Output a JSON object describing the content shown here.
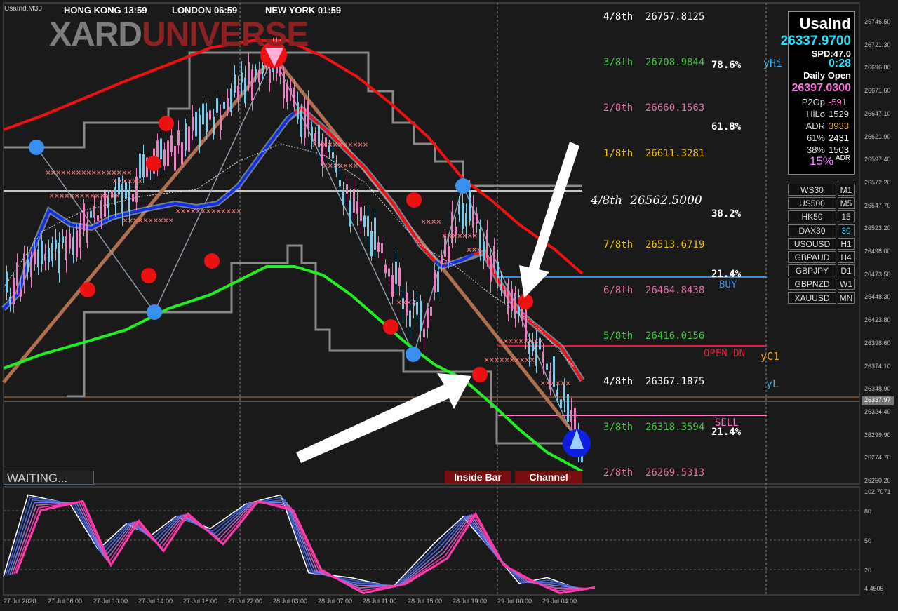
{
  "window": {
    "symbol_title": "UsaInd,M30"
  },
  "sessions": [
    {
      "label": "HONG KONG  13:59",
      "color": "#1f6fd0"
    },
    {
      "label": "LONDON  06:59",
      "color": "#a01a1a"
    },
    {
      "label": "NEW YORK  01:59",
      "color": "#a01a1a"
    }
  ],
  "brand": {
    "part1": "XARD",
    "part2": "UNIVERSE"
  },
  "murrey_levels": [
    {
      "name": "4/8th",
      "value": "26757.8125",
      "color": "#ffffff"
    },
    {
      "name": "3/8th",
      "value": "26708.9844",
      "color": "#3ec83e"
    },
    {
      "name": "2/8th",
      "value": "26660.1563",
      "color": "#e46fa6"
    },
    {
      "name": "1/8th",
      "value": "26611.3281",
      "color": "#f0c000"
    },
    {
      "name": "7/8th",
      "value": "26513.6719",
      "color": "#f0c000"
    },
    {
      "name": "6/8th",
      "value": "26464.8438",
      "color": "#e46fa6"
    },
    {
      "name": "5/8th",
      "value": "26416.0156",
      "color": "#3ec83e"
    },
    {
      "name": "4/8th",
      "value": "26367.1875",
      "color": "#ffffff"
    },
    {
      "name": "3/8th",
      "value": "26318.3594",
      "color": "#3ec83e"
    },
    {
      "name": "2/8th",
      "value": "26269.5313",
      "color": "#e46fa6"
    }
  ],
  "center_level": {
    "name": "4/8th",
    "value": "26562.5000"
  },
  "fib": {
    "p786": "78.6%",
    "p618": "61.8%",
    "p382": "38.2%",
    "p214a": "21.4%",
    "p214b": "21.4%"
  },
  "lines": {
    "yH": "yHi",
    "buy": "BUY",
    "open_dn": "OPEN DN",
    "yC": "yC1",
    "yL": "yL",
    "sell": "SELL"
  },
  "status": {
    "waiting": "WAITING..."
  },
  "tags": {
    "inside_bar": "Inside Bar",
    "channel": "Channel"
  },
  "info": {
    "symbol": "UsaInd",
    "price": "26337.9700",
    "spread": "SPD:47.0",
    "timer": "0:28",
    "daily_open_label": "Daily Open",
    "daily_open": "26397.0300",
    "rows": [
      {
        "label": "P2Op",
        "value": "-591",
        "color": "#ff70d0"
      },
      {
        "label": "HiLo",
        "value": "1529",
        "color": "#dddddd"
      },
      {
        "label": "ADR",
        "value": "3933",
        "color": "#e0a020"
      },
      {
        "label": "61%",
        "value": "2431",
        "color": "#ffffff"
      },
      {
        "label": "38%",
        "value": "1503",
        "color": "#ffffff"
      }
    ],
    "adr_pct": "15%",
    "adr_suffix": "ADR"
  },
  "symbol_buttons": [
    {
      "sym": "WS30",
      "tf": "M1"
    },
    {
      "sym": "US500",
      "tf": "M5"
    },
    {
      "sym": "HK50",
      "tf": "15"
    },
    {
      "sym": "DAX30",
      "tf": "30",
      "active": true
    },
    {
      "sym": "USOUSD",
      "tf": "H1"
    },
    {
      "sym": "GBPAUD",
      "tf": "H4"
    },
    {
      "sym": "GBPJPY",
      "tf": "D1"
    },
    {
      "sym": "GBPNZD",
      "tf": "W1"
    },
    {
      "sym": "XAUUSD",
      "tf": "MN"
    }
  ],
  "price_axis": [
    "26746.50",
    "26721.30",
    "26696.80",
    "26671.60",
    "26647.10",
    "26621.90",
    "26597.40",
    "26572.20",
    "26547.70",
    "26523.20",
    "26498.00",
    "26473.50",
    "26448.30",
    "26423.80",
    "26398.60",
    "26374.10",
    "26348.90",
    "26324.40",
    "26299.90",
    "26274.70",
    "26250.20"
  ],
  "current_price_tag": "26337.97",
  "osc_axis": [
    "102.7071",
    "80",
    "50",
    "20",
    "4.4505"
  ],
  "time_axis": [
    "27 Jul 2020",
    "27 Jul 06:00",
    "27 Jul 10:00",
    "27 Jul 14:00",
    "27 Jul 18:00",
    "27 Jul 22:00",
    "28 Jul 03:00",
    "28 Jul 07:00",
    "28 Jul 11:00",
    "28 Jul 15:00",
    "28 Jul 19:00",
    "29 Jul 00:00",
    "29 Jul 04:00"
  ],
  "colors": {
    "bg": "#1a1a1a",
    "up": "#7ec8e8",
    "down": "#e680c0",
    "red_ma": "#ee1111",
    "green_ma": "#22ee22",
    "blue_ma": "#1030e0"
  }
}
